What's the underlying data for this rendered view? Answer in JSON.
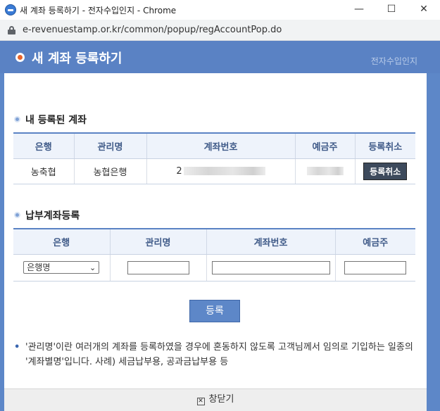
{
  "window": {
    "title": "새 계좌 등록하기 - 전자수입인지 - Chrome",
    "controls": [
      "minimize",
      "maximize",
      "close"
    ]
  },
  "address_bar": {
    "url": "e-revenuestamp.or.kr/common/popup/regAccountPop.do"
  },
  "header": {
    "title": "새 계좌 등록하기",
    "brand": "전자수입인지"
  },
  "registered": {
    "section_title": "내 등록된 계좌",
    "columns": [
      "은행",
      "관리명",
      "계좌번호",
      "예금주",
      "등록취소"
    ],
    "rows": [
      {
        "bank": "농축협",
        "alias": "농협은행",
        "account_prefix": "2",
        "cancel_label": "등록취소"
      }
    ]
  },
  "register_form": {
    "section_title": "납부계좌등록",
    "columns": [
      "은행",
      "관리명",
      "계좌번호",
      "예금주"
    ],
    "bank_select": "은행명",
    "alias_value": "",
    "account_value": "",
    "holder_value": ""
  },
  "submit_label": "등록",
  "note": "'관리명'이란 여러개의 계좌를 등록하였을 경우에 혼동하지 않도록 고객님께서 임의로 기입하는 일종의 '계좌별명'입니다. 사례) 세금납부용, 공과금납부용 등",
  "footer": {
    "close_label": "창닫기"
  },
  "colors": {
    "header_bg": "#5a82c4",
    "accent": "#e8642c",
    "table_header_text": "#3f5a88"
  }
}
